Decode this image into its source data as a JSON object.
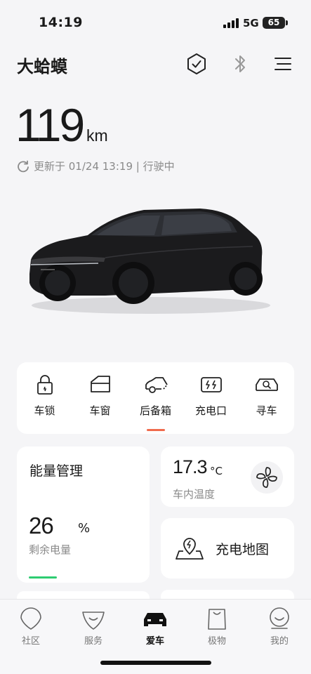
{
  "status_bar": {
    "time": "14:19",
    "network": "5G",
    "battery": "65"
  },
  "header": {
    "car_name": "大蛤蟆"
  },
  "range": {
    "value": "119",
    "unit": "km",
    "update_text": "更新于 01/24 13:19 | 行驶中"
  },
  "controls": [
    {
      "label": "车锁",
      "icon": "lock-icon"
    },
    {
      "label": "车窗",
      "icon": "window-icon"
    },
    {
      "label": "后备箱",
      "icon": "trunk-icon",
      "active": true
    },
    {
      "label": "充电口",
      "icon": "charge-port-icon"
    },
    {
      "label": "寻车",
      "icon": "find-car-icon"
    }
  ],
  "energy": {
    "title": "能量管理",
    "percent": "26",
    "percent_unit": "%",
    "label": "剩余电量",
    "level": 0.26
  },
  "temperature": {
    "value": "17.3",
    "unit": "°C",
    "label": "车内温度"
  },
  "charging_map": {
    "label": "充电地图"
  },
  "tabs": [
    {
      "label": "社区",
      "icon": "community-icon"
    },
    {
      "label": "服务",
      "icon": "service-icon"
    },
    {
      "label": "爱车",
      "icon": "car-icon",
      "active": true
    },
    {
      "label": "极物",
      "icon": "shop-bag-icon"
    },
    {
      "label": "我的",
      "icon": "profile-icon"
    }
  ],
  "colors": {
    "accent_active": "#f06b4d",
    "energy_bar": "#2ecc71",
    "text_secondary": "#8a8a8a"
  }
}
